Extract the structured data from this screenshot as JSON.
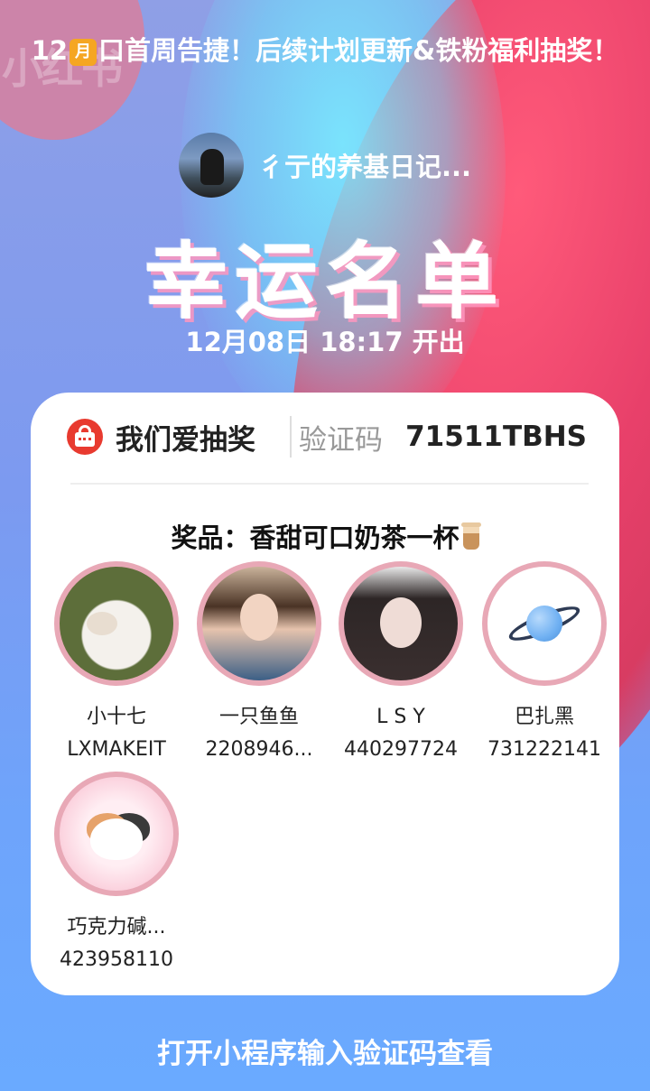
{
  "post": {
    "headline_prefix": "12",
    "calendar_glyph": "月",
    "headline_rest": "口首周告捷！后续计划更新&铁粉福利抽奖！",
    "watermark": "小红书"
  },
  "author": {
    "name": "彳亍的养基日记..."
  },
  "banner": {
    "title": "幸运名单",
    "draw_time": "12月08日 18:17 开出"
  },
  "card": {
    "app_name": "我们爱抽奖",
    "code_label": "验证码",
    "code_value": "71511TBHS",
    "prize": "奖品：香甜可口奶茶一杯"
  },
  "winners": [
    {
      "name": "小十七",
      "uid": "LXMAKEIT",
      "avatar": "cat-photo"
    },
    {
      "name": "一只鱼鱼",
      "uid": "2208946...",
      "avatar": "girl-photo"
    },
    {
      "name": "L S Y",
      "uid": "440297724",
      "avatar": "girl-photo-2"
    },
    {
      "name": "巴扎黑",
      "uid": "731222141",
      "avatar": "planet-icon"
    },
    {
      "name": "巧克力碱...",
      "uid": "423958110",
      "avatar": "kitty-illustration"
    }
  ],
  "footer": {
    "cta": "打开小程序输入验证码查看"
  }
}
